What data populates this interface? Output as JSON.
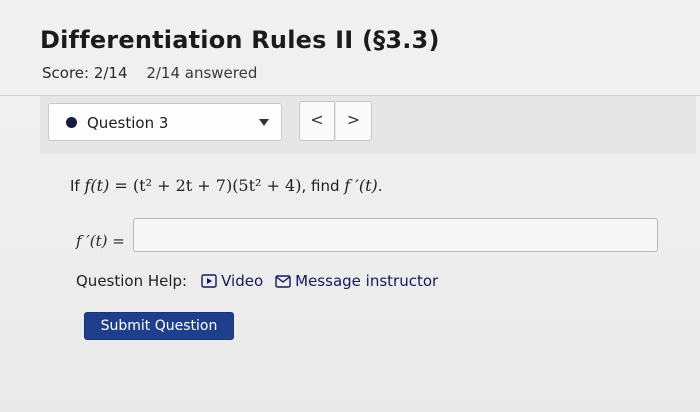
{
  "page": {
    "title": "Differentiation Rules II (§3.3)",
    "score": "Score: 2/14",
    "answered": "2/14 answered"
  },
  "question_nav": {
    "selected": "Question 3",
    "prev_label": "<",
    "next_label": ">"
  },
  "problem": {
    "prefix": "If ",
    "function_lhs": "f(t) = ",
    "factor1": "(t² + 2t + 7)",
    "factor2": "(5t² + 4)",
    "suffix": ", find ",
    "target": "f ′(t)",
    "end": "."
  },
  "answer": {
    "label": "f ′(t) =",
    "value": "",
    "placeholder": ""
  },
  "help": {
    "label": "Question Help:",
    "video_label": "Video",
    "message_label": "Message instructor"
  },
  "actions": {
    "submit_label": "Submit Question"
  },
  "colors": {
    "accent": "#1f3f8c",
    "link": "#14185e",
    "dot": "#151a40"
  }
}
